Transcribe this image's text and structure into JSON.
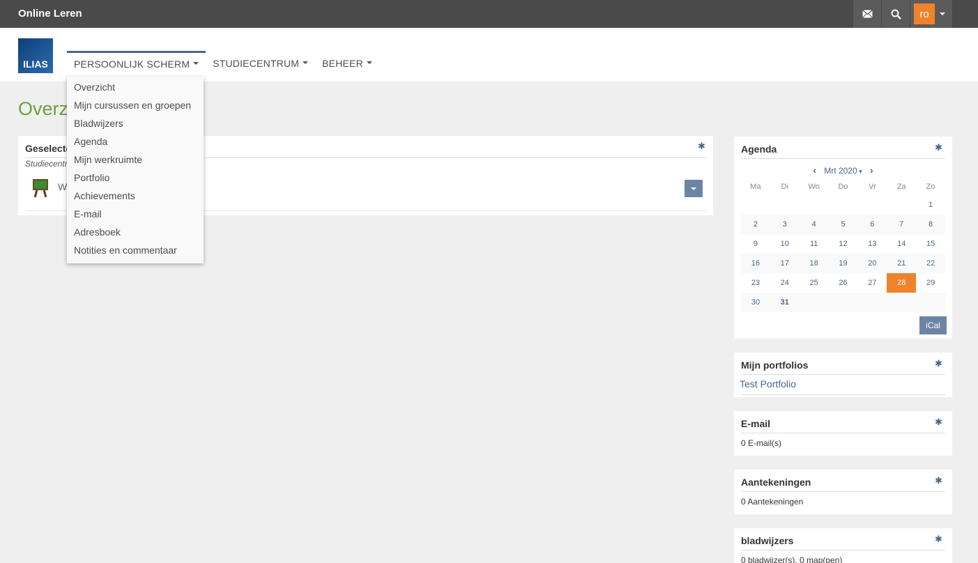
{
  "topbar": {
    "brand": "Online Leren",
    "user_initials": "ro"
  },
  "header": {
    "logo_text": "ILIAS",
    "nav": [
      {
        "label": "PERSOONLIJK SCHERM"
      },
      {
        "label": "STUDIECENTRUM"
      },
      {
        "label": "BEHEER"
      }
    ]
  },
  "dropdown": {
    "items": [
      "Overzicht",
      "Mijn cursussen en groepen",
      "Bladwijzers",
      "Agenda",
      "Mijn werkruimte",
      "Portfolio",
      "Achievements",
      "E-mail",
      "Adresboek",
      "Notities en commentaar"
    ]
  },
  "page": {
    "title_visible": "Overz"
  },
  "selected_panel": {
    "title_visible": "Geselecte",
    "subtitle_visible": "Studiecentr",
    "item_visible": "W"
  },
  "agenda": {
    "title": "Agenda",
    "month": "Mrt 2020",
    "days": [
      "Ma",
      "Di",
      "Wo",
      "Do",
      "Vr",
      "Za",
      "Zo"
    ],
    "weeks": [
      [
        "",
        "",
        "",
        "",
        "",
        "",
        "1"
      ],
      [
        "2",
        "3",
        "4",
        "5",
        "6",
        "7",
        "8"
      ],
      [
        "9",
        "10",
        "11",
        "12",
        "13",
        "14",
        "15"
      ],
      [
        "16",
        "17",
        "18",
        "19",
        "20",
        "21",
        "22"
      ],
      [
        "23",
        "24",
        "25",
        "26",
        "27",
        "28",
        "29"
      ],
      [
        "30",
        "31",
        "",
        "",
        "",
        "",
        ""
      ]
    ],
    "today": "28",
    "ical_label": "iCal"
  },
  "portfolios": {
    "title": "Mijn portfolios",
    "link": "Test Portfolio"
  },
  "email": {
    "title": "E-mail",
    "text": "0 E-mail(s)"
  },
  "notes": {
    "title": "Aantekeningen",
    "text": "0 Aantekeningen"
  },
  "bookmarks": {
    "title": "bladwijzers",
    "text": "0 bladwijzer(s), 0 map(pen)"
  },
  "colors": {
    "topbar": "#4a4a4a",
    "accent_orange": "#f0832a",
    "link_blue": "#4c6586",
    "title_green": "#6ea03c"
  }
}
